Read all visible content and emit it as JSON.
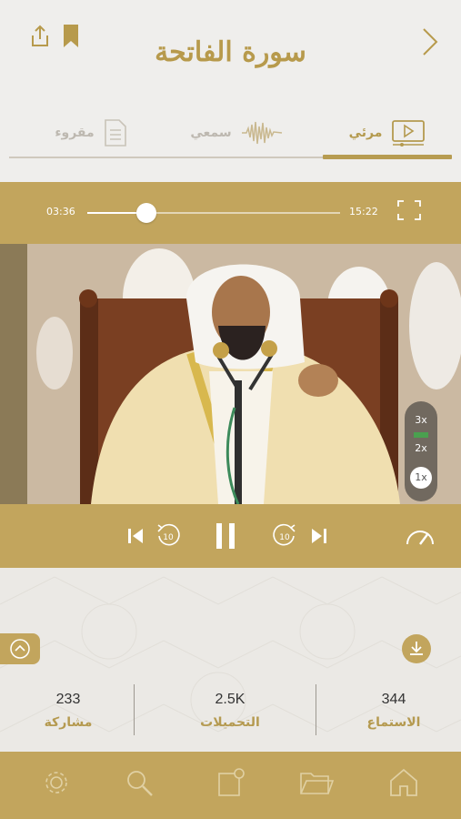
{
  "header": {
    "title": "سورة الفاتحة",
    "icons": [
      "share-icon",
      "bookmark-icon",
      "back-chevron-icon"
    ]
  },
  "tabs": [
    {
      "label": "مرئي",
      "icon": "video-play-icon",
      "active": true
    },
    {
      "label": "سمعي",
      "icon": "waveform-icon",
      "active": false
    },
    {
      "label": "مقروء",
      "icon": "document-icon",
      "active": false
    }
  ],
  "player": {
    "current_time": "03:36",
    "total_time": "15:22",
    "progress_fraction": 0.234,
    "speed_options": [
      "3x",
      "2x",
      "1x"
    ],
    "selected_speed": "1x"
  },
  "controls": [
    "previous-icon",
    "rewind-10-icon",
    "pause-icon",
    "forward-10-icon",
    "next-icon",
    "speedometer-icon"
  ],
  "stats": {
    "shares_value": "233",
    "shares_label": "مشاركة",
    "downloads_value": "2.5K",
    "downloads_label": "التحميلات",
    "listens_value": "344",
    "listens_label": "الاستماع"
  },
  "bottom_nav": [
    "settings-gear-icon",
    "search-icon",
    "new-item-icon",
    "folder-icon",
    "home-icon"
  ],
  "colors": {
    "accent": "#c2a55d",
    "title": "#b79a4c",
    "background": "#efedea"
  }
}
